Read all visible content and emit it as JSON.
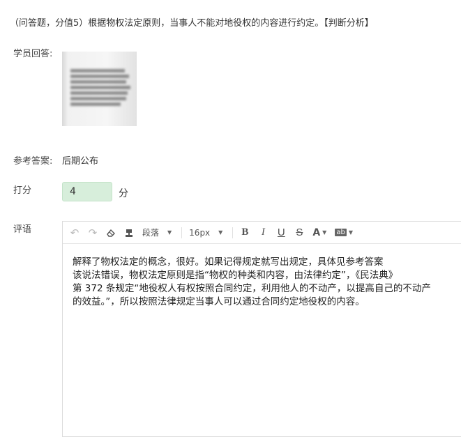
{
  "question": {
    "text": "（问答题，分值5）根据物权法定原则，当事人不能对地役权的内容进行约定。【判断分析】"
  },
  "student_answer": {
    "label": "学员回答:"
  },
  "reference_answer": {
    "label": "参考答案:",
    "value": "后期公布"
  },
  "score": {
    "label": "打分",
    "value": "4",
    "unit": "分"
  },
  "comment": {
    "label": "评语",
    "toolbar": {
      "undo_icon": "↶",
      "redo_icon": "↷",
      "eraser_icon": "⌫",
      "format_painter_icon": "⌂",
      "paragraph_label": "段落",
      "font_size_label": "16px",
      "bold_label": "B",
      "italic_label": "I",
      "underline_label": "U",
      "strike_label": "S",
      "font_color_label": "A",
      "highlight_label": "ab"
    },
    "content_lines": [
      "解释了物权法定的概念，很好。如果记得规定就写出规定，具体见参考答案",
      "该说法错误，物权法定原则是指“物权的种类和内容，由法律约定”，《民法典》",
      "第 372 条规定“地役权人有权按照合同约定，利用他人的不动产，以提高自己的不动产",
      "的效益。”，所以按照法律规定当事人可以通过合同约定地役权的内容。"
    ]
  },
  "colors": {
    "score_bg": "#d7eedb",
    "border": "#dcdcdc"
  }
}
